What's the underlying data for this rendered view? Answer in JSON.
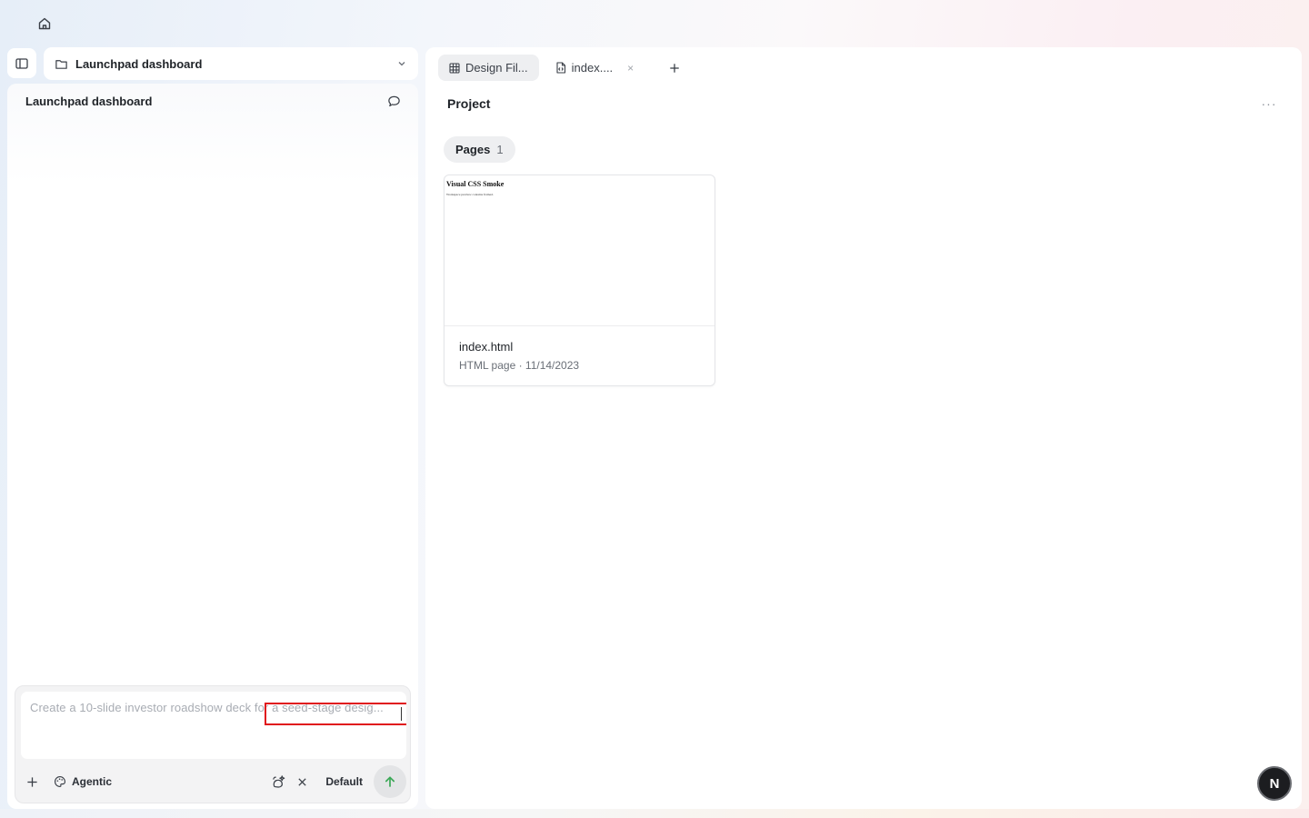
{
  "nav": {
    "home_icon": "home-icon",
    "sidebar_toggle_icon": "sidebar-toggle-icon"
  },
  "project_selector": {
    "label": "Launchpad dashboard",
    "icon": "folder-icon",
    "chevron": "chevron-down-icon"
  },
  "conversation": {
    "title": "Launchpad dashboard",
    "icon": "comment-icon"
  },
  "composer": {
    "placeholder": "Create a 10-slide investor roadshow deck for a seed-stage desig...",
    "add_icon": "plus-icon",
    "mode_label": "Agentic",
    "mode_icon": "palette-icon",
    "tool_icon": "magic-tool-icon",
    "clear_icon": "close-icon",
    "model_label": "Default",
    "send_icon": "arrow-up-icon",
    "send_color": "#3aa856"
  },
  "tabs": [
    {
      "label": "Design Fil...",
      "icon": "grid-icon",
      "active": true
    },
    {
      "label": "index....",
      "icon": "file-code-icon",
      "active": false,
      "close": "×"
    }
  ],
  "add_tab_icon": "plus-icon",
  "main": {
    "title": "Project",
    "more": "···",
    "pages_chip": {
      "label": "Pages",
      "count": "1"
    },
    "file_card": {
      "thumb_title": "Visual CSS Smoke",
      "thumb_sub": "Workspace preview contains framed.",
      "name": "index.html",
      "meta": "HTML page · 11/14/2023"
    }
  },
  "avatar": {
    "initial": "N"
  }
}
